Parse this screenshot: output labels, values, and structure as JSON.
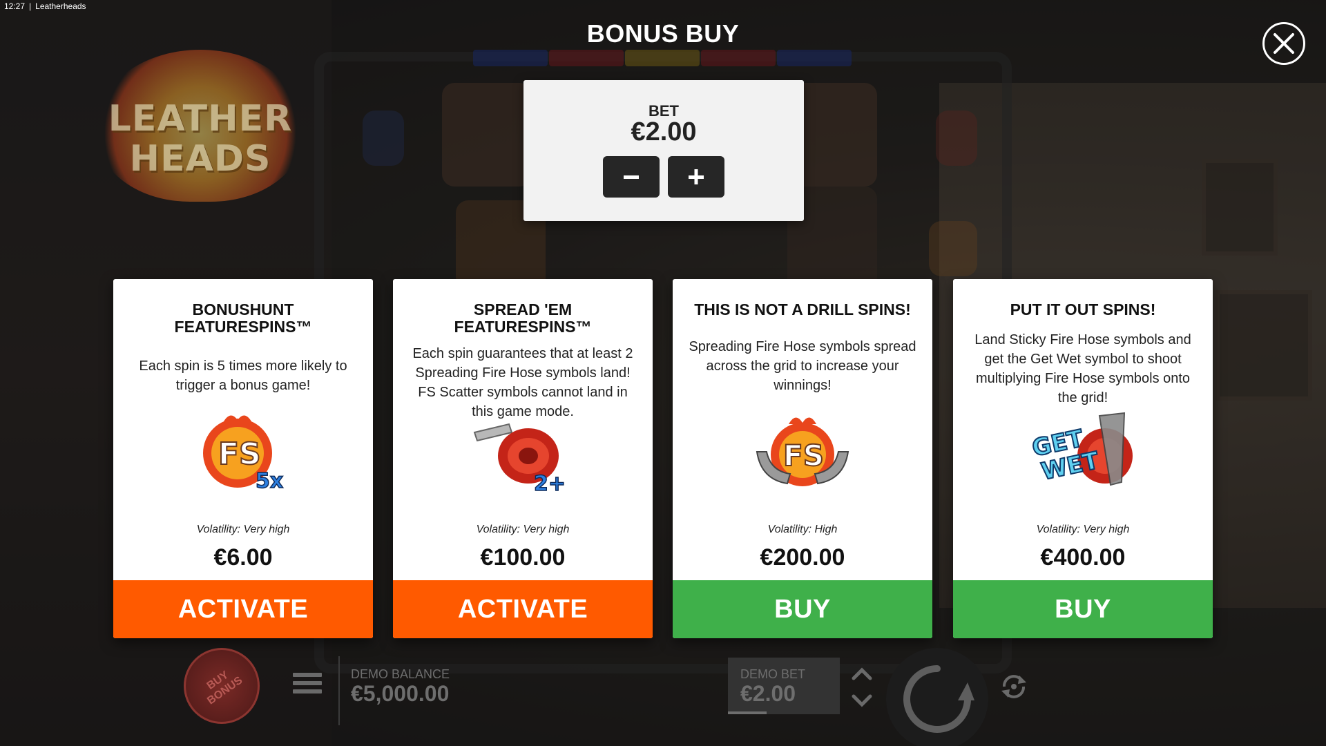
{
  "window": {
    "time": "12:27",
    "title": "Leatherheads"
  },
  "logo": {
    "line1": "LEATHER",
    "line2": "HEADS"
  },
  "bonus_buy": {
    "title": "BONUS BUY",
    "close_icon": "close-icon"
  },
  "bet": {
    "label": "BET",
    "value": "€2.00",
    "minus": "−",
    "plus": "+"
  },
  "cards": [
    {
      "title": "BONUSHUNT FEATURESPINS™",
      "description": "Each spin is 5 times more likely to trigger a bonus game!",
      "icon": "fs-5x-badge-icon",
      "volatility": "Volatility: Very high",
      "price": "€6.00",
      "action": "ACTIVATE",
      "action_color": "#ff5a00"
    },
    {
      "title": "SPREAD 'EM FEATURESPINS™",
      "description": "Each spin guarantees that at least 2 Spreading Fire Hose symbols land! FS Scatter symbols cannot land in this game mode.",
      "icon": "fire-hose-2plus-icon",
      "volatility": "Volatility: Very high",
      "price": "€100.00",
      "action": "ACTIVATE",
      "action_color": "#ff5a00"
    },
    {
      "title": "THIS IS NOT A DRILL SPINS!",
      "description": "Spreading Fire Hose symbols spread across the grid to increase your winnings!",
      "icon": "fs-fire-hose-icon",
      "volatility": "Volatility: High",
      "price": "€200.00",
      "action": "BUY",
      "action_color": "#3fb04a"
    },
    {
      "title": "PUT IT OUT SPINS!",
      "description": "Land Sticky Fire Hose symbols and get the Get Wet symbol to shoot multiplying Fire Hose symbols onto the grid!",
      "icon": "get-wet-hose-icon",
      "volatility": "Volatility: Very high",
      "price": "€400.00",
      "action": "BUY",
      "action_color": "#3fb04a"
    }
  ],
  "bottom_bar": {
    "buy_bonus_line1": "BUY",
    "buy_bonus_line2": "BONUS",
    "balance_label": "DEMO BALANCE",
    "balance_value": "€5,000.00",
    "bet_label": "DEMO BET",
    "bet_value": "€2.00"
  },
  "colors": {
    "activate": "#ff5a00",
    "buy": "#3fb04a",
    "panel": "#f2f2f2",
    "overlay": "rgba(12,12,12,0.55)"
  }
}
